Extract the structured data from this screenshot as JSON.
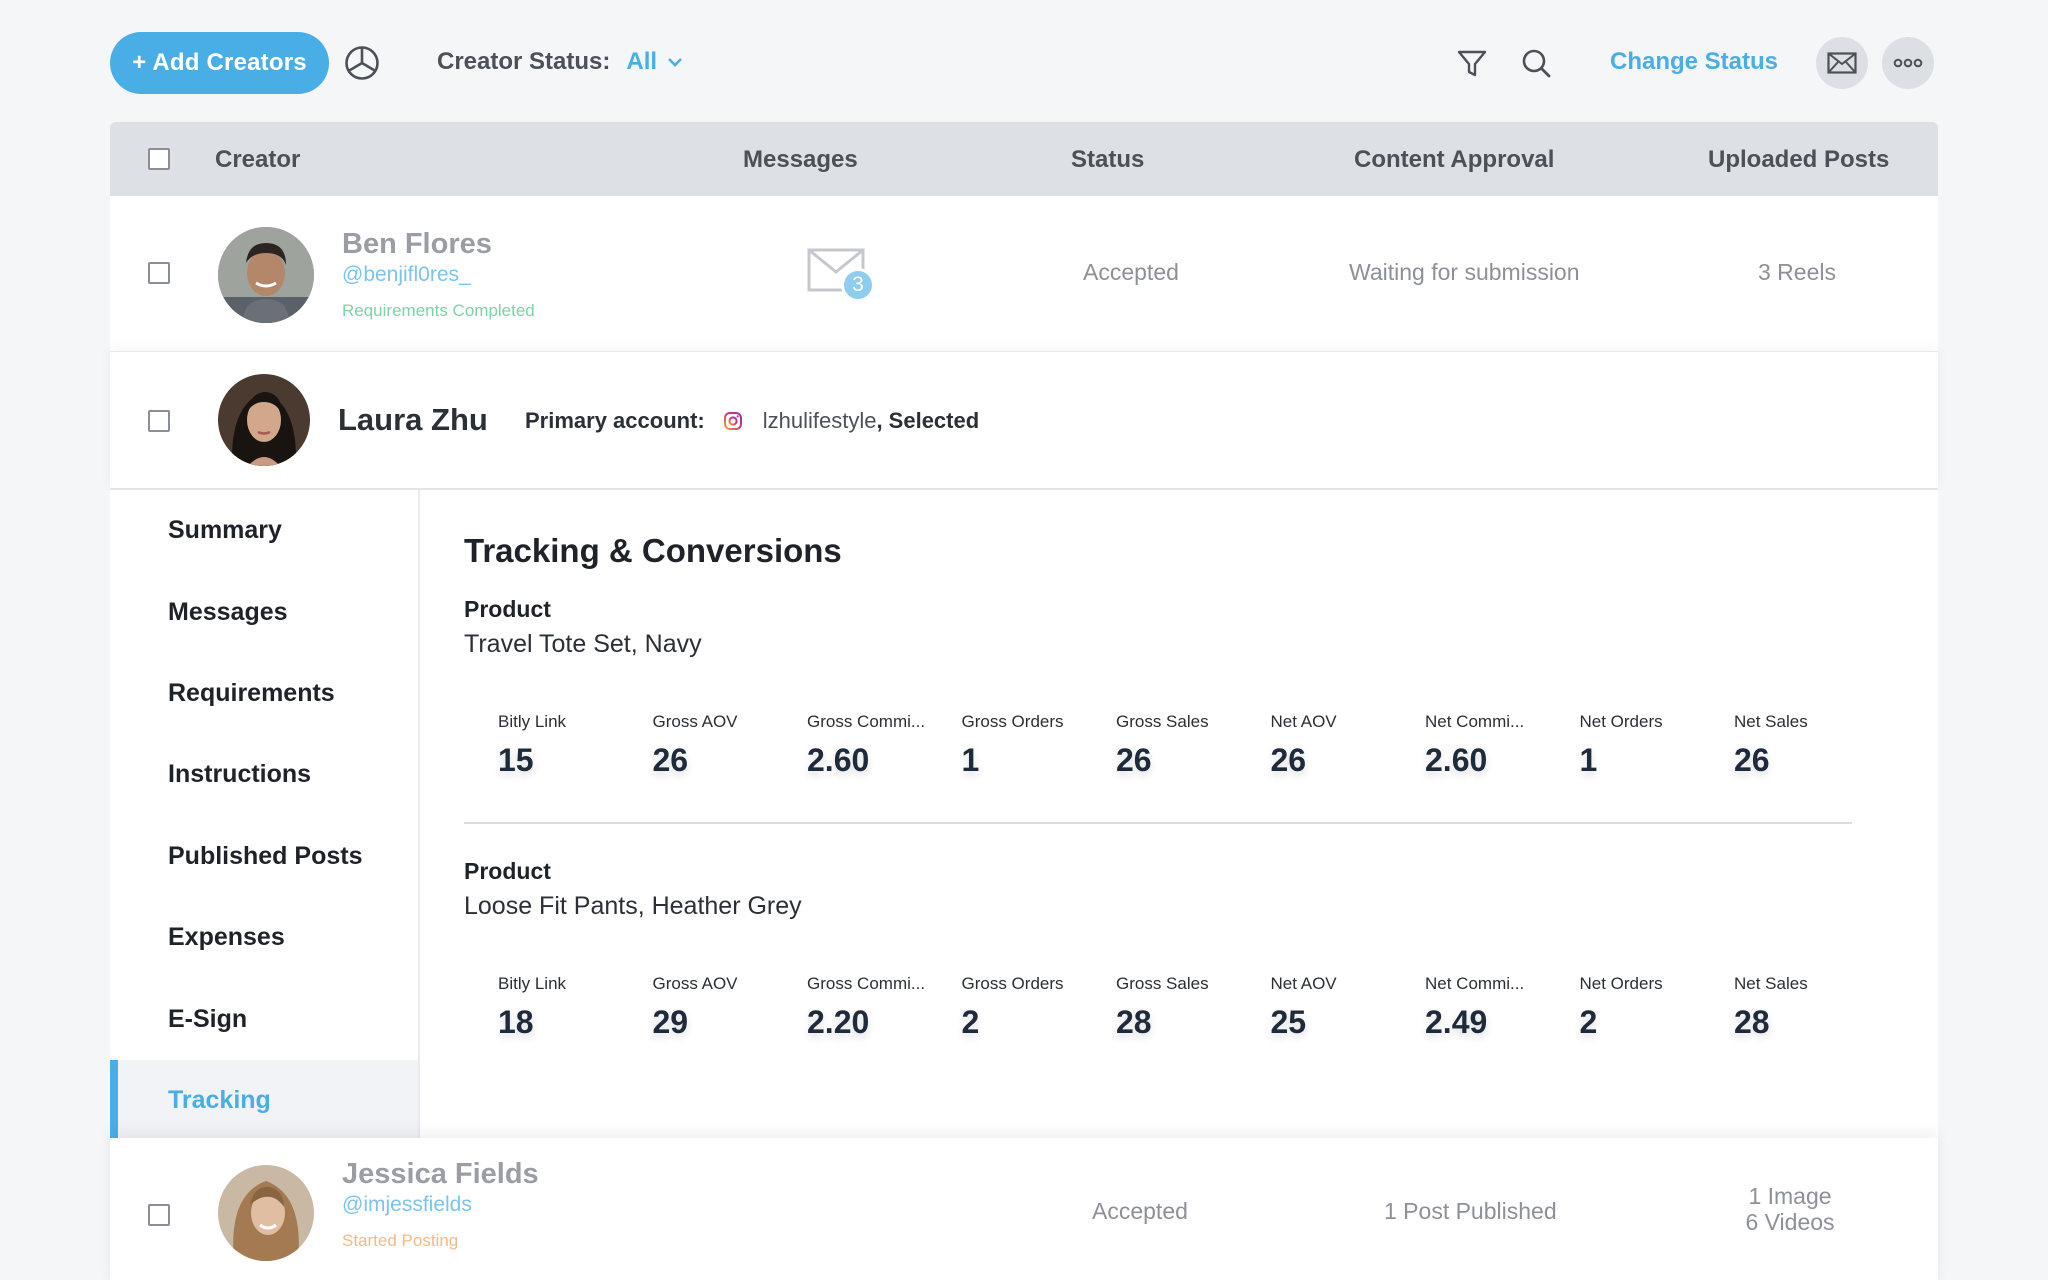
{
  "toolbar": {
    "add_label": "+ Add Creators",
    "status_label": "Creator Status:",
    "status_value": "All",
    "change_status_label": "Change Status",
    "accent": "#4aaee6"
  },
  "table": {
    "headers": {
      "creator": "Creator",
      "messages": "Messages",
      "status": "Status",
      "content_approval": "Content Approval",
      "uploaded_posts": "Uploaded Posts"
    }
  },
  "rows": {
    "ben": {
      "name": "Ben Flores",
      "handle": "@benjifl0res_",
      "stage": "Requirements Completed",
      "stage_color": "#7fd3a6",
      "message_count": "3",
      "status": "Accepted",
      "content_approval": "Waiting for submission",
      "uploaded_posts": "3 Reels"
    },
    "laura": {
      "name": "Laura Zhu",
      "primary_label": "Primary account:",
      "account": "lzhulifestyle",
      "account_suffix": ", Selected"
    },
    "jessica": {
      "name": "Jessica Fields",
      "handle": "@imjessfields",
      "stage": "Started Posting",
      "stage_color": "#f6b98a",
      "status": "Accepted",
      "content_approval": "1 Post Published",
      "uploaded_posts_line1": "1 Image",
      "uploaded_posts_line2": "6 Videos"
    }
  },
  "side_nav": [
    "Summary",
    "Messages",
    "Requirements",
    "Instructions",
    "Published Posts",
    "Expenses",
    "E-Sign",
    "Tracking"
  ],
  "active_nav": "Tracking",
  "tracking": {
    "title": "Tracking & Conversions",
    "products": [
      {
        "label": "Product",
        "name": "Travel Tote Set, Navy",
        "metrics": [
          {
            "label": "Bitly Link",
            "value": "15"
          },
          {
            "label": "Gross AOV",
            "value": "26"
          },
          {
            "label": "Gross Commi...",
            "value": "2.60"
          },
          {
            "label": "Gross Orders",
            "value": "1"
          },
          {
            "label": "Gross Sales",
            "value": "26"
          },
          {
            "label": "Net AOV",
            "value": "26"
          },
          {
            "label": "Net Commi...",
            "value": "2.60"
          },
          {
            "label": "Net Orders",
            "value": "1"
          },
          {
            "label": "Net Sales",
            "value": "26"
          }
        ]
      },
      {
        "label": "Product",
        "name": "Loose Fit Pants, Heather Grey",
        "metrics": [
          {
            "label": "Bitly Link",
            "value": "18"
          },
          {
            "label": "Gross AOV",
            "value": "29"
          },
          {
            "label": "Gross Commi...",
            "value": "2.20"
          },
          {
            "label": "Gross Orders",
            "value": "2"
          },
          {
            "label": "Gross Sales",
            "value": "28"
          },
          {
            "label": "Net AOV",
            "value": "25"
          },
          {
            "label": "Net Commi...",
            "value": "2.49"
          },
          {
            "label": "Net Orders",
            "value": "2"
          },
          {
            "label": "Net Sales",
            "value": "28"
          }
        ]
      }
    ]
  }
}
